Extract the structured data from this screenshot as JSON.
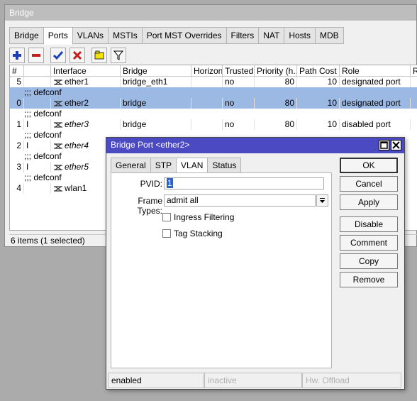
{
  "bridge_window": {
    "title": "Bridge",
    "tabs": [
      "Bridge",
      "Ports",
      "VLANs",
      "MSTIs",
      "Port MST Overrides",
      "Filters",
      "NAT",
      "Hosts",
      "MDB"
    ],
    "active_tab": "Ports",
    "toolbar": {
      "add": "add-icon",
      "remove": "remove-icon",
      "enable": "check-icon",
      "disable": "x-icon",
      "comment": "comment-icon",
      "filter": "filter-icon"
    },
    "columns": [
      "#",
      "",
      "Interface",
      "Bridge",
      "Horizon",
      "Trusted",
      "Priority (h...",
      "Path Cost",
      "Role",
      "Ro"
    ],
    "rows": [
      {
        "num": "5",
        "flag": "",
        "interface": "ether1",
        "bridge": "bridge_eth1",
        "horizon": "",
        "trusted": "no",
        "priority": "80",
        "path_cost": "10",
        "role": "designated port"
      },
      {
        "comment": ";;; defconf"
      },
      {
        "num": "0",
        "flag": "",
        "interface": "ether2",
        "bridge": "bridge",
        "horizon": "",
        "trusted": "no",
        "priority": "80",
        "path_cost": "10",
        "role": "designated port"
      },
      {
        "comment": ";;; defconf"
      },
      {
        "num": "1",
        "flag": "I",
        "interface": "ether3",
        "bridge": "bridge",
        "horizon": "",
        "trusted": "no",
        "priority": "80",
        "path_cost": "10",
        "role": "disabled port"
      },
      {
        "comment": ";;; defconf"
      },
      {
        "num": "2",
        "flag": "I",
        "interface": "ether4"
      },
      {
        "comment": ";;; defconf"
      },
      {
        "num": "3",
        "flag": "I",
        "interface": "ether5"
      },
      {
        "comment": ";;; defconf"
      },
      {
        "num": "4",
        "flag": "",
        "interface": "wlan1"
      }
    ],
    "status": "6 items (1 selected)"
  },
  "dialog": {
    "title": "Bridge Port <ether2>",
    "tabs": [
      "General",
      "STP",
      "VLAN",
      "Status"
    ],
    "active_tab": "VLAN",
    "pvid_label": "PVID:",
    "pvid_value": "1",
    "frame_types_label": "Frame Types:",
    "frame_types_value": "admit all",
    "ingress_filtering_label": "Ingress Filtering",
    "ingress_filtering_checked": false,
    "tag_stacking_label": "Tag Stacking",
    "tag_stacking_checked": false,
    "buttons": [
      "OK",
      "Cancel",
      "Apply",
      "Disable",
      "Comment",
      "Copy",
      "Remove"
    ],
    "status": [
      "enabled",
      "inactive",
      "Hw. Offload"
    ]
  },
  "colors": {
    "selection": "#9cb9e3",
    "dialog_title": "#4c4ac3",
    "add_icon": "#1f3fb5",
    "remove_icon": "#c41e1e",
    "check_icon": "#1f3fb5",
    "x_icon": "#c41e1e",
    "comment_icon": "#f5e400"
  }
}
